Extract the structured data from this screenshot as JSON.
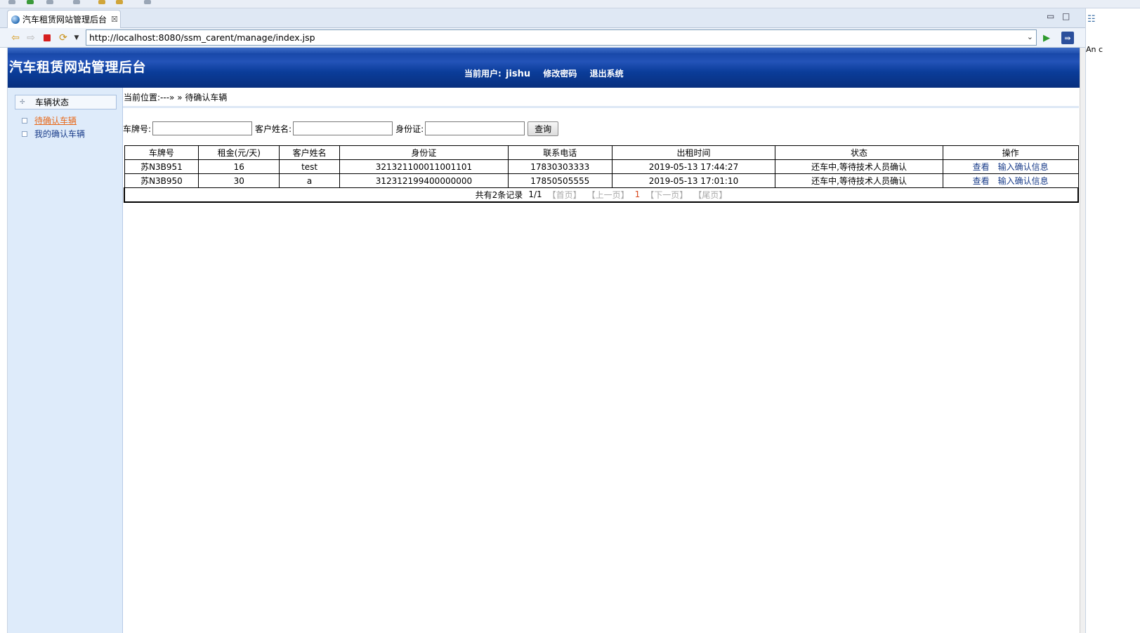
{
  "browser": {
    "tab_title": "汽车租赁网站管理后台",
    "tab_close": "☒",
    "url": "http://localhost:8080/ssm_carent/manage/index.jsp",
    "minimize": "▭",
    "maximize": "□"
  },
  "ide_right": {
    "text": "An c"
  },
  "header": {
    "site_title": "汽车租赁网站管理后台",
    "current_user_label": "当前用户:",
    "current_user": "jishu",
    "change_password": "修改密码",
    "logout": "退出系统"
  },
  "sidebar": {
    "group_label": "车辆状态",
    "items": [
      {
        "label": "待确认车辆",
        "active": true
      },
      {
        "label": "我的确认车辆",
        "active": false
      }
    ]
  },
  "breadcrumb": "当前位置:---» » 待确认车辆",
  "search": {
    "plate_label": "车牌号:",
    "plate_value": "",
    "customer_label": "客户姓名:",
    "customer_value": "",
    "idcard_label": "身份证:",
    "idcard_value": "",
    "query_button": "查询"
  },
  "table": {
    "headers": [
      "车牌号",
      "租金(元/天)",
      "客户姓名",
      "身份证",
      "联系电话",
      "出租时间",
      "状态",
      "操作"
    ],
    "rows": [
      {
        "plate": "苏N3B951",
        "rent": "16",
        "customer": "test",
        "idcard": "321321100011001101",
        "phone": "17830303333",
        "rent_time": "2019-05-13 17:44:27",
        "status": "还车中,等待技术人员确认",
        "op_view": "查看",
        "op_confirm": "输入确认信息"
      },
      {
        "plate": "苏N3B950",
        "rent": "30",
        "customer": "a",
        "idcard": "312312199400000000",
        "phone": "17850505555",
        "rent_time": "2019-05-13 17:01:10",
        "status": "还车中,等待技术人员确认",
        "op_view": "查看",
        "op_confirm": "输入确认信息"
      }
    ],
    "pager": {
      "total": "共有2条记录",
      "page": "1/1",
      "first": "【首页】",
      "prev": "【上一页】",
      "current": "1",
      "next": "【下一页】",
      "last": "【尾页】"
    }
  }
}
